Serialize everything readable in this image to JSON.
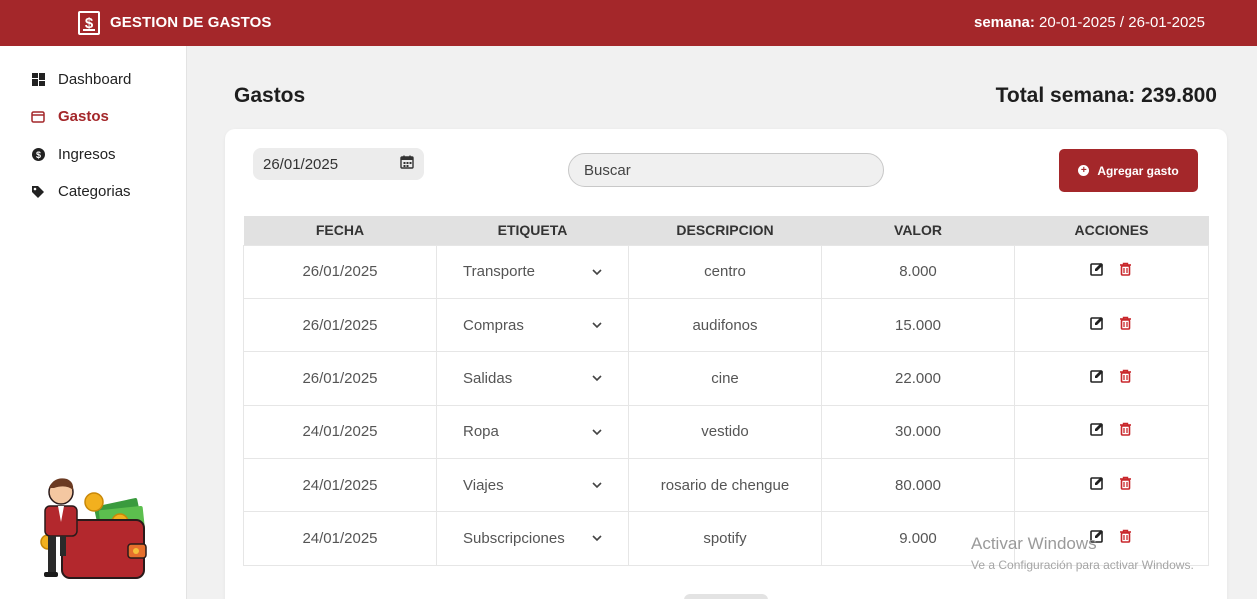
{
  "header": {
    "logo_symbol": "$",
    "title": "GESTION DE GASTOS",
    "week_label": "semana:",
    "week_range": "20-01-2025 / 26-01-2025"
  },
  "sidebar": {
    "items": [
      {
        "label": "Dashboard",
        "icon": "grid-icon",
        "active": false
      },
      {
        "label": "Gastos",
        "icon": "wallet-icon",
        "active": true
      },
      {
        "label": "Ingresos",
        "icon": "dollar-circle-icon",
        "active": false
      },
      {
        "label": "Categorias",
        "icon": "tag-icon",
        "active": false
      }
    ]
  },
  "main": {
    "title": "Gastos",
    "total_label": "Total semana: 239.800"
  },
  "toolbar": {
    "date_value": "26/01/2025",
    "search_placeholder": "Buscar",
    "add_label": "Agregar gasto"
  },
  "table": {
    "columns": [
      "FECHA",
      "ETIQUETA",
      "DESCRIPCION",
      "VALOR",
      "ACCIONES"
    ],
    "rows": [
      {
        "fecha": "26/01/2025",
        "etiqueta": "Transporte",
        "descripcion": "centro",
        "valor": "8.000"
      },
      {
        "fecha": "26/01/2025",
        "etiqueta": "Compras",
        "descripcion": "audifonos",
        "valor": "15.000"
      },
      {
        "fecha": "26/01/2025",
        "etiqueta": "Salidas",
        "descripcion": "cine",
        "valor": "22.000"
      },
      {
        "fecha": "24/01/2025",
        "etiqueta": "Ropa",
        "descripcion": "vestido",
        "valor": "30.000"
      },
      {
        "fecha": "24/01/2025",
        "etiqueta": "Viajes",
        "descripcion": "rosario de chengue",
        "valor": "80.000"
      },
      {
        "fecha": "24/01/2025",
        "etiqueta": "Subscripciones",
        "descripcion": "spotify",
        "valor": "9.000"
      }
    ]
  },
  "os_watermark": {
    "line1": "Activar Windows",
    "line2": "Ve a Configuración para activar Windows."
  },
  "colors": {
    "brand": "#a4272a",
    "delete": "#c8262b"
  }
}
